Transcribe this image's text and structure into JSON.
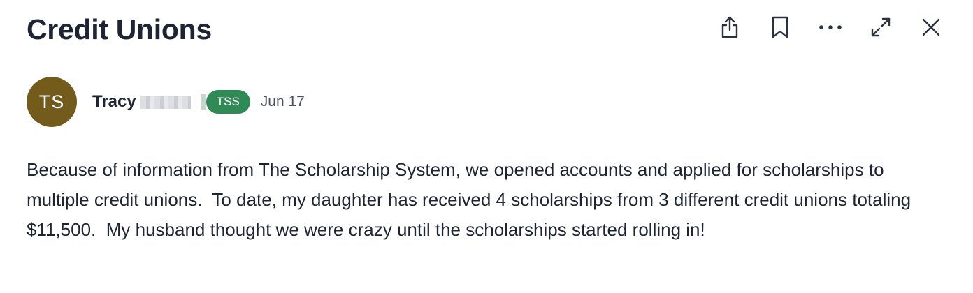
{
  "post": {
    "title": "Credit Unions",
    "author": {
      "initials": "TS",
      "first_name": "Tracy",
      "avatar_color": "#735b1b"
    },
    "badge": {
      "label": "TSS",
      "color": "#2f8a55"
    },
    "date": "Jun 17",
    "body": "Because of information from The Scholarship System, we opened accounts and applied for scholarships to multiple credit unions.  To date, my daughter has received 4 scholarships from 3 different credit unions totaling $11,500.  My husband thought we were crazy until the scholarships started rolling in!"
  },
  "toolbar": {
    "icons": [
      "share-icon",
      "bookmark-icon",
      "more-icon",
      "expand-icon",
      "close-icon"
    ]
  }
}
